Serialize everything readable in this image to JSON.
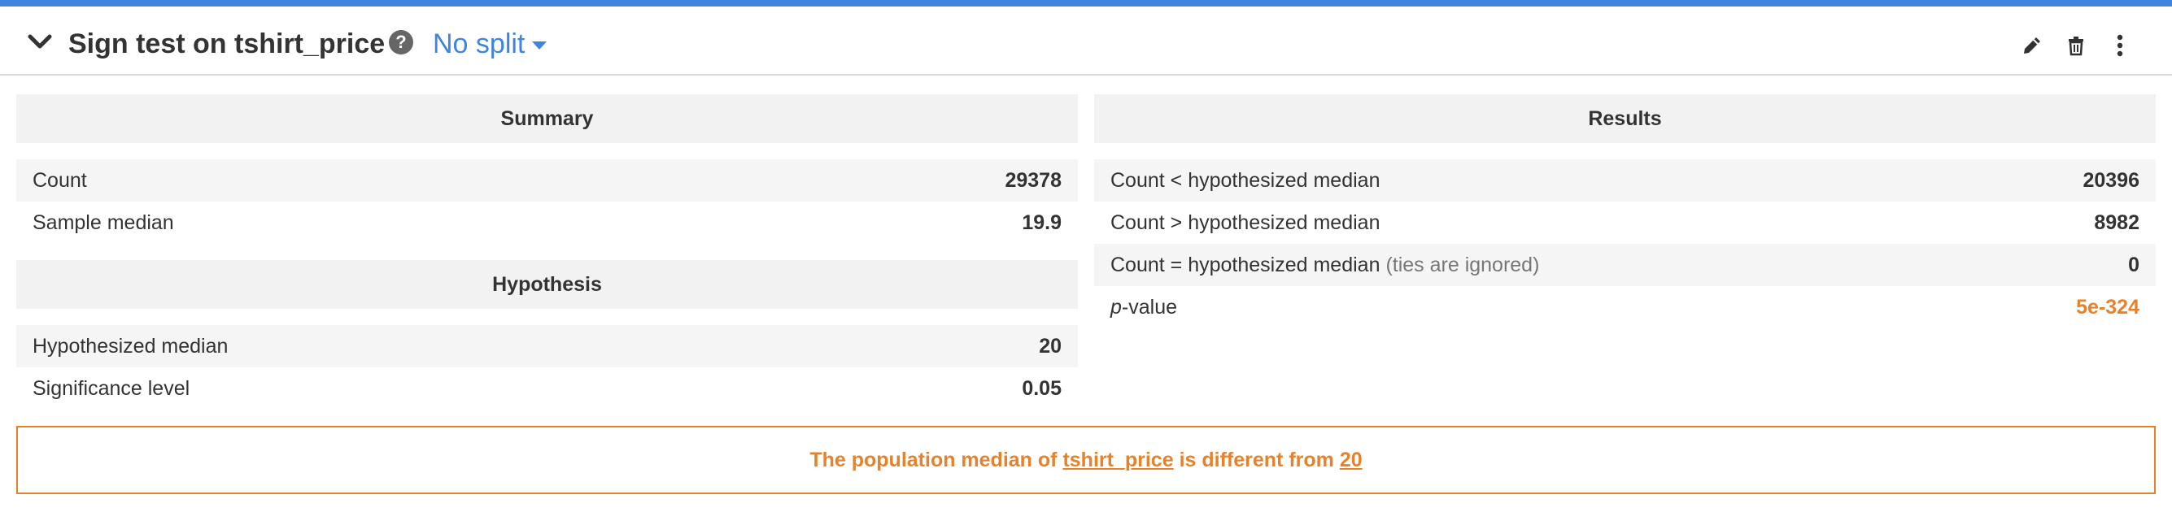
{
  "header": {
    "title": "Sign test on tshirt_price",
    "split_label": "No split",
    "help_glyph": "?"
  },
  "summary": {
    "heading": "Summary",
    "rows": [
      {
        "label": "Count",
        "value": "29378"
      },
      {
        "label": "Sample median",
        "value": "19.9"
      }
    ]
  },
  "hypothesis": {
    "heading": "Hypothesis",
    "rows": [
      {
        "label": "Hypothesized median",
        "value": "20"
      },
      {
        "label": "Significance level",
        "value": "0.05"
      }
    ]
  },
  "results": {
    "heading": "Results",
    "rows": [
      {
        "label": "Count < hypothesized median",
        "value": "20396"
      },
      {
        "label": "Count > hypothesized median",
        "value": "8982"
      },
      {
        "label": "Count = hypothesized median",
        "note": "(ties are ignored)",
        "value": "0"
      },
      {
        "label_italic": "p",
        "label": "-value",
        "value": "5e-324"
      }
    ]
  },
  "verdict": {
    "prefix": "The population median of",
    "variable": "tshirt_price",
    "middle": "is different from",
    "target": "20"
  },
  "colors": {
    "accent": "#3d85e0",
    "warning": "#e8822a"
  },
  "icons": [
    "chevron-down-icon",
    "help-icon",
    "caret-down-icon",
    "pencil-icon",
    "trash-icon",
    "more-vertical-icon"
  ]
}
